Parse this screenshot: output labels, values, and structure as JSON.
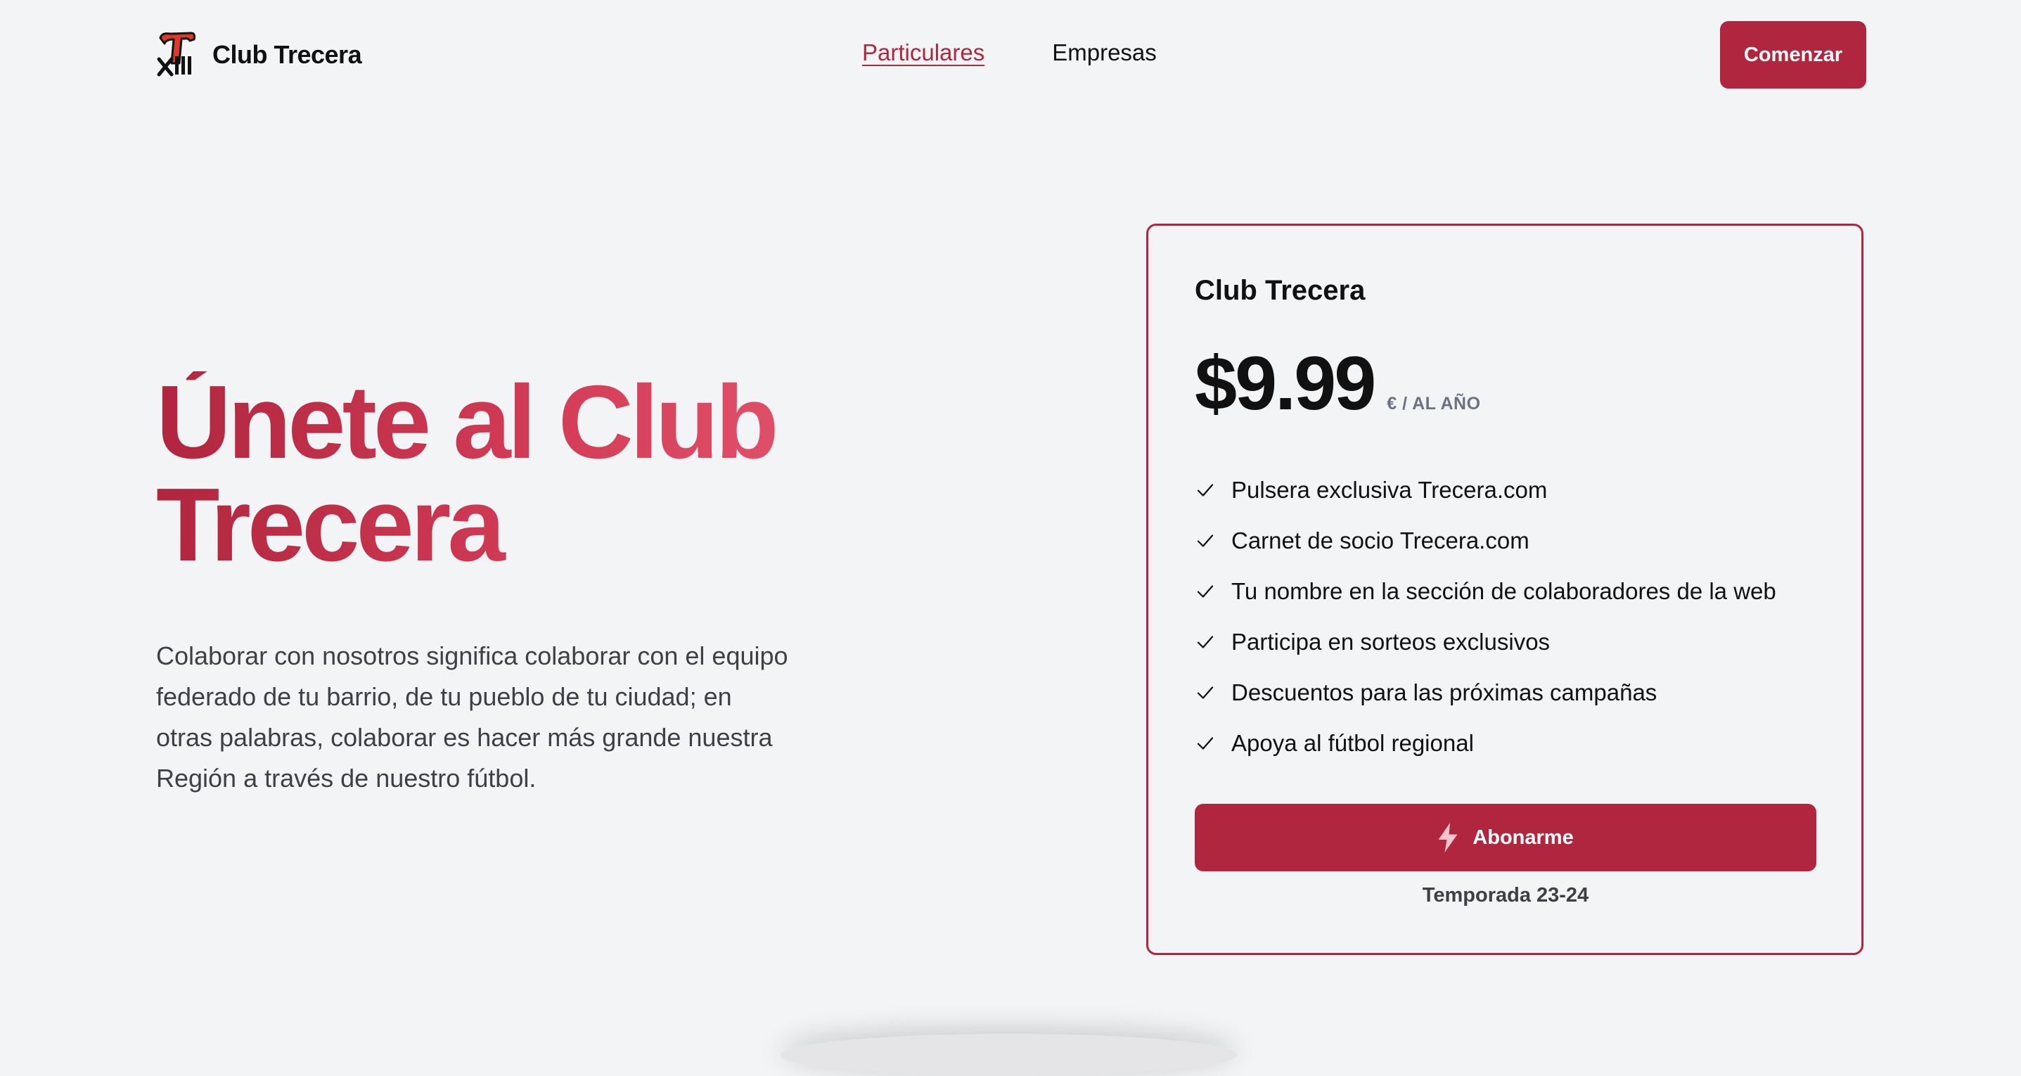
{
  "header": {
    "brand_name": "Club Trecera",
    "logo_icon": "club-trecera-logo",
    "nav": [
      {
        "label": "Particulares",
        "active": true
      },
      {
        "label": "Empresas",
        "active": false
      }
    ],
    "cta_label": "Comenzar"
  },
  "hero": {
    "title": "Únete al Club Trecera",
    "description": "Colaborar con nosotros significa colaborar con el equipo federado de tu barrio, de tu pueblo de tu ciudad; en otras palabras, colaborar es hacer más grande nuestra Región a través de nuestro fútbol."
  },
  "pricing": {
    "title": "Club Trecera",
    "price": "$9.99",
    "period": "€ / AL AÑO",
    "features": [
      "Pulsera exclusiva Trecera.com",
      "Carnet de socio Trecera.com",
      "Tu nombre en la sección de colaboradores de la web",
      "Participa en sorteos exclusivos",
      "Descuentos para las próximas campañas",
      "Apoya al fútbol regional"
    ],
    "button_label": "Abonarme",
    "button_icon": "bolt-icon",
    "season": "Temporada 23-24"
  },
  "colors": {
    "accent": "#b0263e",
    "gradient_end": "#eb5f78",
    "background": "#f3f4f6"
  }
}
